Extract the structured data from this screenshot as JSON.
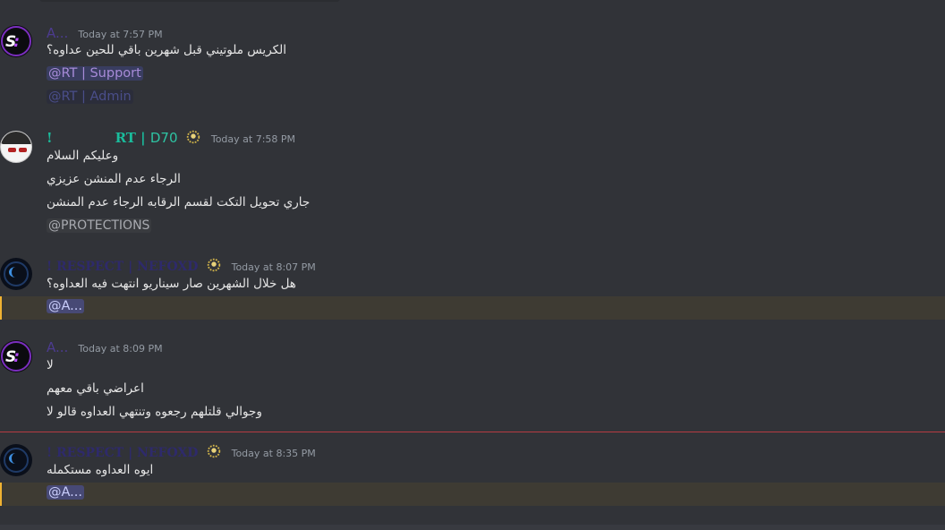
{
  "messages": [
    {
      "username": "A...",
      "timestamp": "Today at 7:57 PM",
      "avatar": "s-logo-avatar",
      "lines": [
        "الكريس ملوتيني قبل شهرين باقي للحين عداوه؟"
      ],
      "mentions": [
        "@RT | Support",
        "@RT | Admin"
      ]
    },
    {
      "username_prefix": "!",
      "username_main": "RT |",
      "username_tail": "D70",
      "timestamp": "Today at 7:58 PM",
      "avatar": "anime-avatar",
      "badge": "laurel-badge-icon",
      "lines": [
        "وعليكم السلام",
        "الرجاء عدم المنشن عزيزي",
        "جاري تحويل التكت لقسم الرقابه الرجاء عدم المنشن"
      ],
      "mentions": [
        "@PROTECTIONS"
      ]
    },
    {
      "username": "! RESPECT | NEFOXD",
      "timestamp": "Today at 8:07 PM",
      "avatar": "dark-avatar",
      "badge": "laurel-badge-icon",
      "lines": [
        "هل خلال الشهرين صار سيناريو انتهت فيه العداوه؟"
      ],
      "mentions": [
        "@A..."
      ]
    },
    {
      "username": "A...",
      "timestamp": "Today at 8:09 PM",
      "avatar": "s-logo-avatar",
      "lines": [
        "لا",
        "اعراضي باقي معهم",
        "وجوالي قلتلهم رجعوه وتنتهي العداوه قالو لا"
      ]
    },
    {
      "username": "! RESPECT | NEFOXD",
      "timestamp": "Today at 8:35 PM",
      "avatar": "dark-avatar",
      "badge": "laurel-badge-icon",
      "lines": [
        "ايوه العداوه مستكمله"
      ],
      "mentions": [
        "@A..."
      ]
    }
  ],
  "colors": {
    "background": "#313338",
    "mention_highlight": "#3e3b33",
    "new_divider": "#b53b42",
    "role_green": "#1abc9c"
  }
}
